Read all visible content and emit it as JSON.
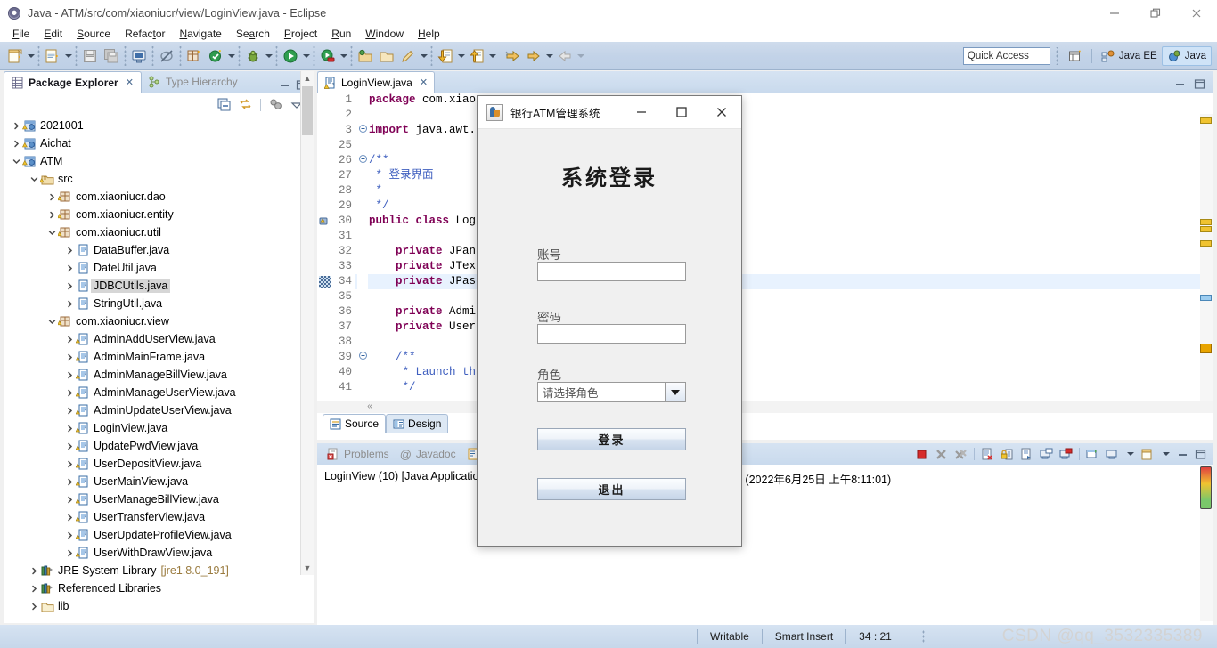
{
  "window": {
    "title": "Java - ATM/src/com/xiaoniucr/view/LoginView.java - Eclipse",
    "app_icon": "eclipse-icon",
    "minimize": "−",
    "restore": "❐",
    "close": "✕"
  },
  "menubar": {
    "items": [
      {
        "label": "File",
        "mnemonic": "F"
      },
      {
        "label": "Edit",
        "mnemonic": "E"
      },
      {
        "label": "Source",
        "mnemonic": "S"
      },
      {
        "label": "Refactor",
        "mnemonic": "t"
      },
      {
        "label": "Navigate",
        "mnemonic": "N"
      },
      {
        "label": "Search",
        "mnemonic": "a"
      },
      {
        "label": "Project",
        "mnemonic": "P"
      },
      {
        "label": "Run",
        "mnemonic": "R"
      },
      {
        "label": "Window",
        "mnemonic": "W"
      },
      {
        "label": "Help",
        "mnemonic": "H"
      }
    ]
  },
  "toolbar": {
    "icons": [
      "new-wizard-icon",
      "new-java-class-icon",
      "save-icon",
      "save-all-icon",
      "print-icon",
      "toggle-breakpoint-icon",
      "new-package-icon",
      "build-icon",
      "debug-icon",
      "run-icon",
      "run-coverage-icon",
      "open-type-icon",
      "search-icon",
      "open-task-icon",
      "pencil-icon",
      "next-annotation-icon",
      "previous-annotation-icon",
      "back-icon",
      "forward-icon"
    ],
    "quick_access": {
      "placeholder": "Quick Access",
      "value": "Quick Access"
    },
    "perspectives": [
      {
        "label": "Java EE",
        "icon": "java-ee-perspective-icon",
        "active": false
      },
      {
        "label": "Java",
        "icon": "java-perspective-icon",
        "active": true
      }
    ],
    "open_perspective_icon": "open-perspective-icon"
  },
  "package_explorer": {
    "tabs": [
      {
        "label": "Package Explorer",
        "icon": "package-explorer-icon",
        "active": true,
        "closable": true
      },
      {
        "label": "Type Hierarchy",
        "icon": "type-hierarchy-icon",
        "active": false,
        "closable": false
      }
    ],
    "view_buttons": [
      "minimize-view-icon",
      "maximize-view-icon"
    ],
    "local_toolbar": [
      "collapse-all-icon",
      "link-with-editor-icon",
      "view-menu-filters-icon",
      "view-menu-icon"
    ],
    "tree": [
      {
        "indent": 0,
        "label": "2021001",
        "icon": "java-project-icon",
        "expanded": false,
        "arrow": "right"
      },
      {
        "indent": 0,
        "label": "Aichat",
        "icon": "java-project-icon",
        "expanded": false,
        "arrow": "right"
      },
      {
        "indent": 0,
        "label": "ATM",
        "icon": "java-project-icon",
        "expanded": true,
        "arrow": "down"
      },
      {
        "indent": 1,
        "label": "src",
        "icon": "source-folder-icon",
        "expanded": true,
        "arrow": "down"
      },
      {
        "indent": 2,
        "label": "com.xiaoniucr.dao",
        "icon": "package-icon",
        "expanded": false,
        "arrow": "right"
      },
      {
        "indent": 2,
        "label": "com.xiaoniucr.entity",
        "icon": "package-icon",
        "expanded": false,
        "arrow": "right"
      },
      {
        "indent": 2,
        "label": "com.xiaoniucr.util",
        "icon": "package-icon",
        "expanded": true,
        "arrow": "down"
      },
      {
        "indent": 3,
        "label": "DataBuffer.java",
        "icon": "java-file-icon",
        "expanded": false,
        "arrow": "right"
      },
      {
        "indent": 3,
        "label": "DateUtil.java",
        "icon": "java-file-icon",
        "expanded": false,
        "arrow": "right"
      },
      {
        "indent": 3,
        "label": "JDBCUtils.java",
        "icon": "java-file-icon",
        "expanded": false,
        "arrow": "right",
        "selected": true
      },
      {
        "indent": 3,
        "label": "StringUtil.java",
        "icon": "java-file-icon",
        "expanded": false,
        "arrow": "right"
      },
      {
        "indent": 2,
        "label": "com.xiaoniucr.view",
        "icon": "package-icon",
        "expanded": true,
        "arrow": "down"
      },
      {
        "indent": 3,
        "label": "AdminAddUserView.java",
        "icon": "java-file-warning-icon",
        "expanded": false,
        "arrow": "right"
      },
      {
        "indent": 3,
        "label": "AdminMainFrame.java",
        "icon": "java-file-warning-icon",
        "expanded": false,
        "arrow": "right"
      },
      {
        "indent": 3,
        "label": "AdminManageBillView.java",
        "icon": "java-file-warning-icon",
        "expanded": false,
        "arrow": "right"
      },
      {
        "indent": 3,
        "label": "AdminManageUserView.java",
        "icon": "java-file-warning-icon",
        "expanded": false,
        "arrow": "right"
      },
      {
        "indent": 3,
        "label": "AdminUpdateUserView.java",
        "icon": "java-file-warning-icon",
        "expanded": false,
        "arrow": "right"
      },
      {
        "indent": 3,
        "label": "LoginView.java",
        "icon": "java-file-warning-icon",
        "expanded": false,
        "arrow": "right"
      },
      {
        "indent": 3,
        "label": "UpdatePwdView.java",
        "icon": "java-file-warning-icon",
        "expanded": false,
        "arrow": "right"
      },
      {
        "indent": 3,
        "label": "UserDepositView.java",
        "icon": "java-file-warning-icon",
        "expanded": false,
        "arrow": "right"
      },
      {
        "indent": 3,
        "label": "UserMainView.java",
        "icon": "java-file-warning-icon",
        "expanded": false,
        "arrow": "right"
      },
      {
        "indent": 3,
        "label": "UserManageBillView.java",
        "icon": "java-file-warning-icon",
        "expanded": false,
        "arrow": "right"
      },
      {
        "indent": 3,
        "label": "UserTransferView.java",
        "icon": "java-file-warning-icon",
        "expanded": false,
        "arrow": "right"
      },
      {
        "indent": 3,
        "label": "UserUpdateProfileView.java",
        "icon": "java-file-warning-icon",
        "expanded": false,
        "arrow": "right"
      },
      {
        "indent": 3,
        "label": "UserWithDrawView.java",
        "icon": "java-file-warning-icon",
        "expanded": false,
        "arrow": "right"
      },
      {
        "indent": 1,
        "label": "JRE System Library",
        "suffix": "[jre1.8.0_191]",
        "icon": "library-icon",
        "expanded": false,
        "arrow": "right"
      },
      {
        "indent": 1,
        "label": "Referenced Libraries",
        "icon": "library-icon",
        "expanded": false,
        "arrow": "right"
      },
      {
        "indent": 1,
        "label": "lib",
        "icon": "folder-icon",
        "expanded": false,
        "arrow": "right"
      }
    ]
  },
  "editor": {
    "tab": {
      "label": "LoginView.java",
      "icon": "java-file-warning-icon",
      "close": "✕"
    },
    "view_buttons": [
      "minimize-editor-icon",
      "maximize-editor-icon"
    ],
    "lines": [
      {
        "num": "1",
        "fold": "",
        "marker": "",
        "tokens": [
          {
            "t": "package ",
            "c": "k"
          },
          {
            "t": "com.xiao",
            "c": "pl"
          }
        ]
      },
      {
        "num": "2",
        "fold": "",
        "marker": "",
        "tokens": []
      },
      {
        "num": "3",
        "fold": "+",
        "marker": "",
        "tokens": [
          {
            "t": "import ",
            "c": "k"
          },
          {
            "t": "java.awt.",
            "c": "pl"
          }
        ]
      },
      {
        "num": "25",
        "fold": "",
        "marker": "",
        "tokens": []
      },
      {
        "num": "26",
        "fold": "-",
        "marker": "",
        "tokens": [
          {
            "t": "/**",
            "c": "cm"
          }
        ]
      },
      {
        "num": "27",
        "fold": "",
        "marker": "",
        "tokens": [
          {
            "t": " * ",
            "c": "cm"
          },
          {
            "t": "登录界面",
            "c": "cm"
          }
        ]
      },
      {
        "num": "28",
        "fold": "",
        "marker": "",
        "tokens": [
          {
            "t": " *",
            "c": "cm"
          }
        ]
      },
      {
        "num": "29",
        "fold": "",
        "marker": "",
        "tokens": [
          {
            "t": " */",
            "c": "cm"
          }
        ]
      },
      {
        "num": "30",
        "fold": "",
        "marker": "warning",
        "tokens": [
          {
            "t": "public class ",
            "c": "k"
          },
          {
            "t": "Log",
            "c": "pl"
          }
        ]
      },
      {
        "num": "31",
        "fold": "",
        "marker": "",
        "tokens": []
      },
      {
        "num": "32",
        "fold": "",
        "marker": "",
        "tokens": [
          {
            "t": "    private ",
            "c": "k"
          },
          {
            "t": "JPan",
            "c": "pl"
          }
        ]
      },
      {
        "num": "33",
        "fold": "",
        "marker": "",
        "tokens": [
          {
            "t": "    private ",
            "c": "k"
          },
          {
            "t": "JTex",
            "c": "pl"
          }
        ]
      },
      {
        "num": "34",
        "fold": "",
        "marker": "cursor",
        "highlight": true,
        "tokens": [
          {
            "t": "    private ",
            "c": "k"
          },
          {
            "t": "JPas",
            "c": "pl"
          }
        ]
      },
      {
        "num": "35",
        "fold": "",
        "marker": "",
        "tokens": []
      },
      {
        "num": "36",
        "fold": "",
        "marker": "",
        "tokens": [
          {
            "t": "    private ",
            "c": "k"
          },
          {
            "t": "Admi",
            "c": "pl"
          }
        ]
      },
      {
        "num": "37",
        "fold": "",
        "marker": "",
        "tokens": [
          {
            "t": "    private ",
            "c": "k"
          },
          {
            "t": "User",
            "c": "pl"
          }
        ]
      },
      {
        "num": "38",
        "fold": "",
        "marker": "",
        "tokens": []
      },
      {
        "num": "39",
        "fold": "-",
        "marker": "",
        "tokens": [
          {
            "t": "    /**",
            "c": "cm"
          }
        ]
      },
      {
        "num": "40",
        "fold": "",
        "marker": "",
        "tokens": [
          {
            "t": "     * Launch th",
            "c": "cm"
          }
        ]
      },
      {
        "num": "41",
        "fold": "",
        "marker": "",
        "tokens": [
          {
            "t": "     */",
            "c": "cm"
          }
        ]
      }
    ],
    "bottom_tabs": [
      {
        "label": "Source",
        "icon": "source-tab-icon",
        "active": true
      },
      {
        "label": "Design",
        "icon": "design-tab-icon",
        "active": false
      }
    ]
  },
  "console": {
    "tabs": [
      {
        "label": "Problems",
        "icon": "problems-icon"
      },
      {
        "label": "Javadoc",
        "icon": "javadoc-icon"
      },
      {
        "label": "Declaration",
        "icon": "declaration-icon"
      }
    ],
    "text_left": "LoginView (10) [Java Applicatio",
    "text_right": "e (2022年6月25日 上午8:11:01)",
    "buttons": [
      "terminate-icon",
      "remove-launch-icon",
      "remove-all-terminated-icon",
      "clear-console-icon",
      "scroll-lock-icon",
      "word-wrap-icon",
      "display-selected-console-icon",
      "pin-console-icon",
      "open-console-icon",
      "new-console-view-icon",
      "minimize-view-icon",
      "maximize-view-icon"
    ]
  },
  "statusbar": {
    "writable": "Writable",
    "insert_mode": "Smart Insert",
    "position": "34 : 21",
    "watermark": "CSDN @qq_3532335389"
  },
  "dialog": {
    "title": "银行ATM管理系统",
    "icon": "java-coffee-cup-icon",
    "minimize": "−",
    "maximize": "□",
    "close": "✕",
    "heading": "系统登录",
    "fields": [
      {
        "label": "账号",
        "type": "text",
        "value": "",
        "placeholder": ""
      },
      {
        "label": "密码",
        "type": "password",
        "value": "",
        "placeholder": ""
      }
    ],
    "role": {
      "label": "角色",
      "selected": "请选择角色"
    },
    "buttons": [
      {
        "label": "登录",
        "name": "login-button"
      },
      {
        "label": "退出",
        "name": "exit-button"
      }
    ]
  }
}
